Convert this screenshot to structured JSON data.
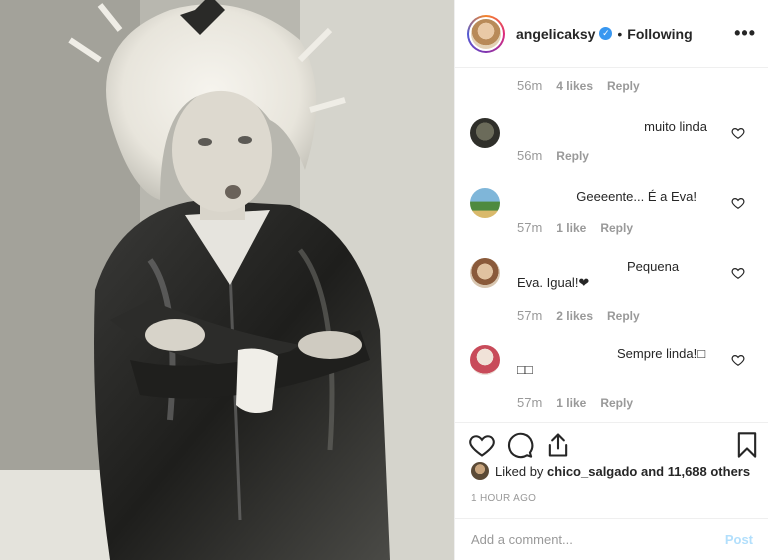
{
  "post": {
    "photo": "vintage black and white photo of a child with teased blond hair wearing a leather jacket, arms crossed",
    "colors": {
      "accent": "#3897f0",
      "post_disabled": "#b2dffc"
    }
  },
  "header": {
    "username": "angelicaksy",
    "verified_icon": "verified-badge-icon",
    "separator": "•",
    "follow_status": "Following",
    "more_label": "•••"
  },
  "comments": [
    {
      "text": "",
      "time": "56m",
      "likes": "4 likes",
      "reply": "Reply"
    },
    {
      "text": "muito linda",
      "time": "56m",
      "likes": "",
      "reply": "Reply"
    },
    {
      "text": "Geeeente... É a Eva!",
      "time": "57m",
      "likes": "1 like",
      "reply": "Reply"
    },
    {
      "text": "Pequena Eva. Igual!❤",
      "time": "57m",
      "likes": "2 likes",
      "reply": "Reply"
    },
    {
      "text": "Sempre linda!□ □□",
      "time": "57m",
      "likes": "1 like",
      "reply": "Reply"
    }
  ],
  "likes": {
    "prefix": "Liked by",
    "user": "chico_salgado",
    "rest": "and 11,688 others"
  },
  "timestamp": "1 HOUR AGO",
  "add_comment": {
    "placeholder": "Add a comment...",
    "post_label": "Post"
  }
}
